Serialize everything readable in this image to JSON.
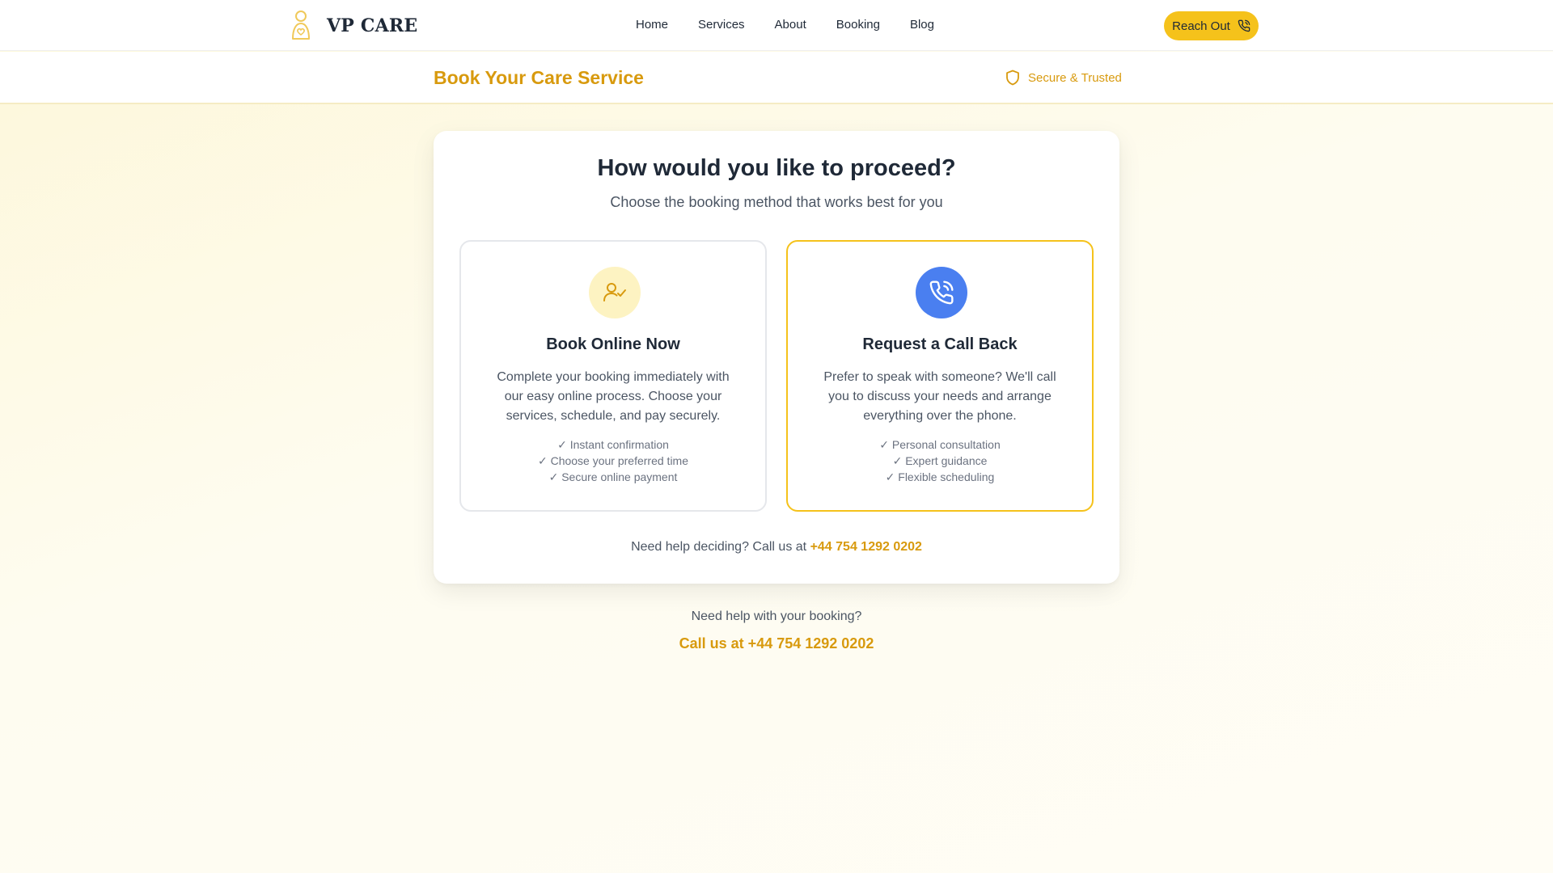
{
  "brand": {
    "name": "VP CARE",
    "accent": "#f5c21b",
    "accent_text": "#d89a0e",
    "logo_icon": "person-heart-icon"
  },
  "nav": {
    "links": [
      "Home",
      "Services",
      "About",
      "Booking",
      "Blog"
    ],
    "cta_label": "Reach Out",
    "cta_icon": "phone-call-icon"
  },
  "subheader": {
    "title": "Book Your Care Service",
    "trust_label": "Secure & Trusted",
    "trust_icon": "shield-icon"
  },
  "card": {
    "title": "How would you like to proceed?",
    "subtitle": "Choose the booking method that works best for you",
    "options": [
      {
        "icon": "user-check-icon",
        "title": "Book Online Now",
        "description": "Complete your booking immediately with our easy online process. Choose your services, schedule, and pay securely.",
        "features": [
          "✓ Instant confirmation",
          "✓ Choose your preferred time",
          "✓ Secure online payment"
        ]
      },
      {
        "icon": "phone-call-icon",
        "title": "Request a Call Back",
        "description": "Prefer to speak with someone? We'll call you to discuss your needs and arrange everything over the phone.",
        "features": [
          "✓ Personal consultation",
          "✓ Expert guidance",
          "✓ Flexible scheduling"
        ],
        "selected": true
      }
    ],
    "help_prefix": "Need help deciding? Call us at",
    "help_phone": "+44 754 1292 0202"
  },
  "footer": {
    "help_text": "Need help with your booking?",
    "call_label": "Call us at +44 754 1292 0202"
  }
}
